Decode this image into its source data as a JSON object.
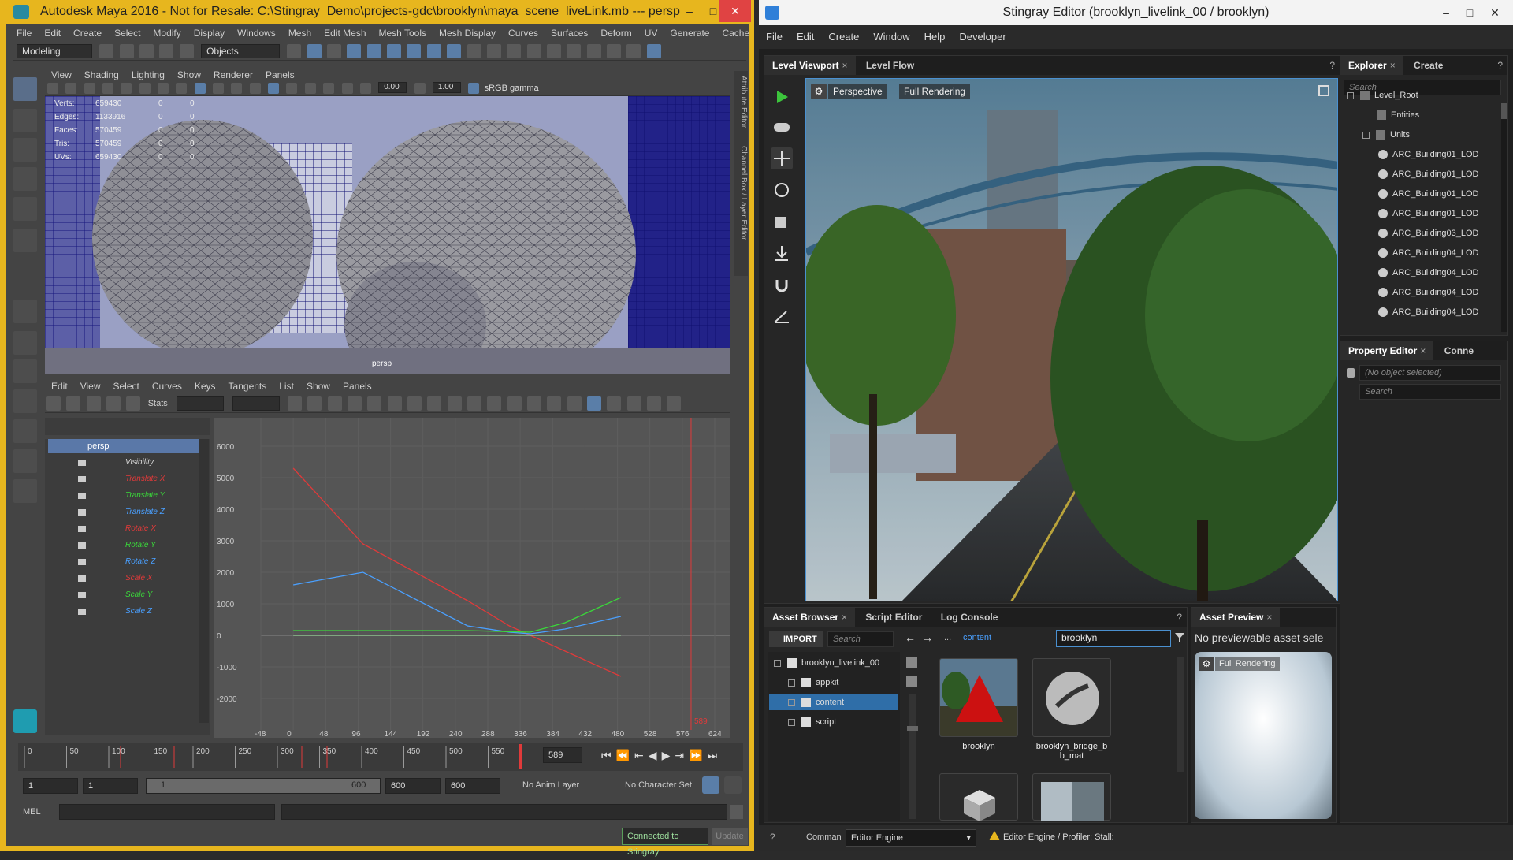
{
  "maya": {
    "title": "Autodesk Maya 2016 - Not for Resale: C:\\Stingray_Demo\\projects-gdc\\brooklyn\\maya_scene_liveLink.mb   ---   persp",
    "menu": [
      "File",
      "Edit",
      "Create",
      "Select",
      "Modify",
      "Display",
      "Windows",
      "Mesh",
      "Edit Mesh",
      "Mesh Tools",
      "Mesh Display",
      "Curves",
      "Surfaces",
      "Deform",
      "UV",
      "Generate",
      "Cache"
    ],
    "mode": "Modeling",
    "objects_field": "Objects",
    "panel_menu": [
      "View",
      "Shading",
      "Lighting",
      "Show",
      "Renderer",
      "Panels"
    ],
    "exposure": "0.00",
    "gamma": "1.00",
    "colorspace": "sRGB gamma",
    "hud": [
      {
        "label": "Verts:",
        "v": "659430",
        "a": "0",
        "b": "0"
      },
      {
        "label": "Edges:",
        "v": "1133916",
        "a": "0",
        "b": "0"
      },
      {
        "label": "Faces:",
        "v": "570459",
        "a": "0",
        "b": "0"
      },
      {
        "label": "Tris:",
        "v": "570459",
        "a": "0",
        "b": "0"
      },
      {
        "label": "UVs:",
        "v": "659430",
        "a": "0",
        "b": "0"
      }
    ],
    "camera_label": "persp",
    "side_tabs": [
      "Attribute Editor",
      "Channel Box / Layer Editor"
    ],
    "graph_menu": [
      "Edit",
      "View",
      "Select",
      "Curves",
      "Keys",
      "Tangents",
      "List",
      "Show",
      "Panels"
    ],
    "stats_label": "Stats",
    "outliner_root": "persp",
    "attributes": [
      {
        "name": "Visibility",
        "color": "#d8d8d8"
      },
      {
        "name": "Translate X",
        "color": "#e03a3a"
      },
      {
        "name": "Translate Y",
        "color": "#3ad83a"
      },
      {
        "name": "Translate Z",
        "color": "#4aa0ff"
      },
      {
        "name": "Rotate X",
        "color": "#e03a3a"
      },
      {
        "name": "Rotate Y",
        "color": "#3ad83a"
      },
      {
        "name": "Rotate Z",
        "color": "#4aa0ff"
      },
      {
        "name": "Scale X",
        "color": "#e03a3a"
      },
      {
        "name": "Scale Y",
        "color": "#3ad83a"
      },
      {
        "name": "Scale Z",
        "color": "#4aa0ff"
      }
    ],
    "graph_y_ticks": [
      "6000",
      "5000",
      "4000",
      "3000",
      "2000",
      "1000",
      "0",
      "-1000",
      "-2000"
    ],
    "graph_x_ticks": [
      "-48",
      "0",
      "48",
      "96",
      "144",
      "192",
      "240",
      "288",
      "336",
      "384",
      "432",
      "480",
      "528",
      "576",
      "624"
    ],
    "graph_marker": "589",
    "timeline_ticks": [
      "0",
      "50",
      "100",
      "150",
      "200",
      "250",
      "300",
      "350",
      "400",
      "450",
      "500",
      "550"
    ],
    "current_frame": "589",
    "range_start": "1",
    "range_start2": "1",
    "slider_start": "1",
    "slider_end": "600",
    "range_end": "600",
    "range_end2": "600",
    "anim_layer": "No Anim Layer",
    "char_set": "No Character Set",
    "mel_label": "MEL",
    "status": "Connected to Stingray",
    "update_btn": "Update"
  },
  "stingray": {
    "title": "Stingray Editor (brooklyn_livelink_00 / brooklyn)",
    "menu": [
      "File",
      "Edit",
      "Create",
      "Window",
      "Help",
      "Developer"
    ],
    "viewport_tabs": [
      "Level Viewport",
      "Level Flow"
    ],
    "view_mode": "Perspective",
    "render_mode": "Full Rendering",
    "explorer_tabs": [
      "Explorer",
      "Create"
    ],
    "explorer_search": "Search",
    "tree": [
      {
        "label": "Level_Root",
        "type": "folder",
        "indent": 0
      },
      {
        "label": "Entities",
        "type": "folder",
        "indent": 1
      },
      {
        "label": "Units",
        "type": "folder",
        "indent": 1
      },
      {
        "label": "ARC_Building01_LOD",
        "type": "unit",
        "indent": 2
      },
      {
        "label": "ARC_Building01_LOD",
        "type": "unit",
        "indent": 2
      },
      {
        "label": "ARC_Building01_LOD",
        "type": "unit",
        "indent": 2
      },
      {
        "label": "ARC_Building01_LOD",
        "type": "unit",
        "indent": 2
      },
      {
        "label": "ARC_Building03_LOD",
        "type": "unit",
        "indent": 2
      },
      {
        "label": "ARC_Building04_LOD",
        "type": "unit",
        "indent": 2
      },
      {
        "label": "ARC_Building04_LOD",
        "type": "unit",
        "indent": 2
      },
      {
        "label": "ARC_Building04_LOD",
        "type": "unit",
        "indent": 2
      },
      {
        "label": "ARC_Building04_LOD",
        "type": "unit",
        "indent": 2
      }
    ],
    "property_tabs": [
      "Property Editor",
      "Conne"
    ],
    "no_object": "(No object selected)",
    "property_search": "Search",
    "asset_tabs": [
      "Asset Browser",
      "Script Editor",
      "Log Console"
    ],
    "import_btn": "IMPORT",
    "asset_search": "Search",
    "path_prefix": "...",
    "path": "content",
    "filter_value": "brooklyn",
    "folders": [
      {
        "label": "brooklyn_livelink_00",
        "indent": 0
      },
      {
        "label": "appkit",
        "indent": 1
      },
      {
        "label": "content",
        "indent": 1
      },
      {
        "label": "script",
        "indent": 1
      }
    ],
    "assets": [
      {
        "label": "brooklyn"
      },
      {
        "label": "brooklyn_bridge_b\nb_mat"
      }
    ],
    "preview_tab": "Asset Preview",
    "preview_text": "No previewable asset sele",
    "preview_render": "Full Rendering",
    "command_label": "Comman",
    "command_value": "Editor Engine",
    "status_text": "Editor Engine / Profiler: Stall:"
  }
}
